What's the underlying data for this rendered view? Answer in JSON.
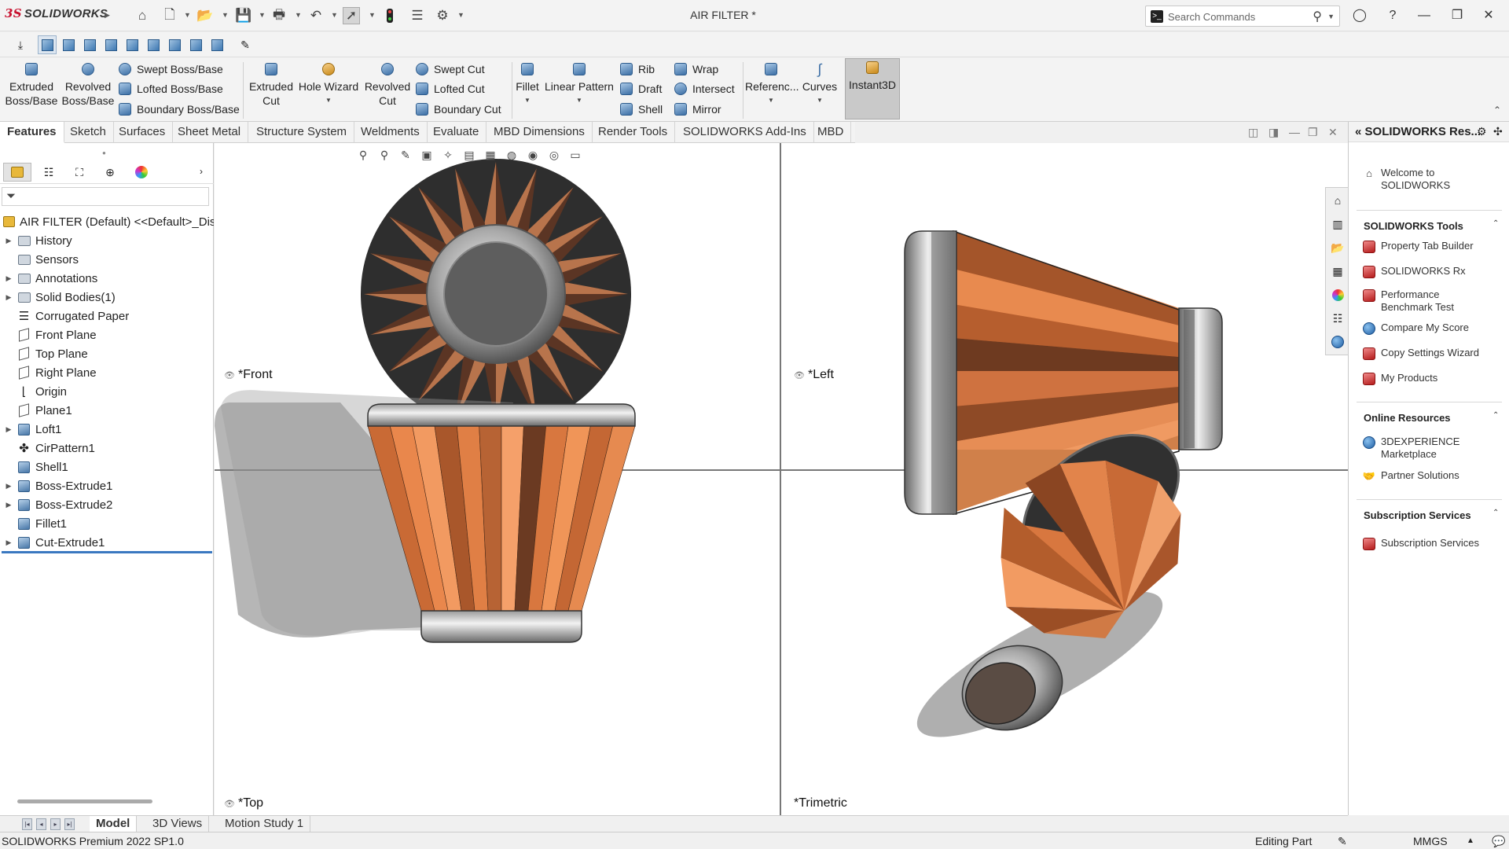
{
  "app": {
    "brand_ds": "3S",
    "brand_name": "SOLIDWORKS",
    "document_title": "AIR FILTER *",
    "search": {
      "placeholder": "Search Commands"
    }
  },
  "ribbon": {
    "extruded_boss": "Extruded Boss/Base",
    "revolved_boss": "Revolved Boss/Base",
    "swept_boss": "Swept Boss/Base",
    "lofted_boss": "Lofted Boss/Base",
    "boundary_boss": "Boundary Boss/Base",
    "extruded_cut": "Extruded Cut",
    "hole_wizard": "Hole Wizard",
    "revolved_cut": "Revolved Cut",
    "swept_cut": "Swept Cut",
    "lofted_cut": "Lofted Cut",
    "boundary_cut": "Boundary Cut",
    "fillet": "Fillet",
    "linear_pattern": "Linear Pattern",
    "rib": "Rib",
    "draft": "Draft",
    "shell": "Shell",
    "wrap": "Wrap",
    "intersect": "Intersect",
    "mirror": "Mirror",
    "reference": "Referenc...",
    "curves": "Curves",
    "instant3d": "Instant3D"
  },
  "tabs": [
    "Features",
    "Sketch",
    "Surfaces",
    "Sheet Metal",
    "Structure System",
    "Weldments",
    "Evaluate",
    "MBD Dimensions",
    "Render Tools",
    "SOLIDWORKS Add-Ins",
    "MBD"
  ],
  "feature_tree": {
    "root": "AIR FILTER (Default) <<Default>_Dis",
    "items": [
      "History",
      "Sensors",
      "Annotations",
      "Solid Bodies(1)",
      "Corrugated Paper",
      "Front Plane",
      "Top Plane",
      "Right Plane",
      "Origin",
      "Plane1",
      "Loft1",
      "CirPattern1",
      "Shell1",
      "Boss-Extrude1",
      "Boss-Extrude2",
      "Fillet1",
      "Cut-Extrude1"
    ]
  },
  "viewports": {
    "front": "*Front",
    "left": "*Left",
    "top": "*Top",
    "trimetric": "*Trimetric"
  },
  "task_pane": {
    "title": "SOLIDWORKS Res...",
    "welcome": "Welcome to SOLIDWORKS",
    "tools_header": "SOLIDWORKS Tools",
    "tools": [
      "Property Tab Builder",
      "SOLIDWORKS Rx",
      "Performance Benchmark Test",
      "Compare My Score",
      "Copy Settings Wizard",
      "My Products"
    ],
    "online_header": "Online Resources",
    "online": [
      "3DEXPERIENCE Marketplace",
      "Partner Solutions"
    ],
    "subs_header": "Subscription Services",
    "subs": [
      "Subscription Services"
    ]
  },
  "bottom_tabs": [
    "Model",
    "3D Views",
    "Motion Study 1"
  ],
  "status": {
    "product": "SOLIDWORKS Premium 2022 SP1.0",
    "mode": "Editing Part",
    "units": "MMGS"
  },
  "colors": {
    "filter_orange": "#e0854a",
    "filter_dark": "#6b3a22",
    "metal": "#c9c9c9",
    "brand_red": "#c8102e",
    "rollback_blue": "#3a78c0"
  }
}
